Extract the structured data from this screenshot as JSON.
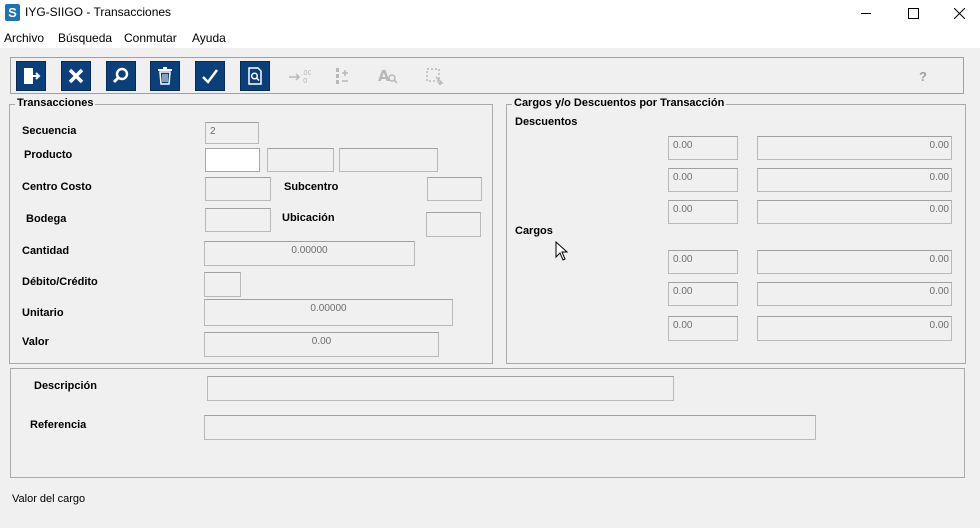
{
  "window": {
    "title": "IYG-SIIGO - Transacciones",
    "logo_letter": "S"
  },
  "menu": {
    "items": [
      "Archivo",
      "Búsqueda",
      "Conmutar",
      "Ayuda"
    ]
  },
  "toolbar": {
    "buttons": [
      {
        "icon": "exit-door-icon",
        "enabled": true
      },
      {
        "icon": "cancel-x-icon",
        "enabled": true
      },
      {
        "icon": "search-magnifier-icon",
        "enabled": true
      },
      {
        "icon": "trash-icon",
        "enabled": true
      },
      {
        "icon": "checkmark-icon",
        "enabled": true
      },
      {
        "icon": "preview-document-icon",
        "enabled": true
      },
      {
        "icon": "sequence-icon",
        "enabled": false
      },
      {
        "icon": "numbering-icon",
        "enabled": false
      },
      {
        "icon": "find-text-icon",
        "enabled": false
      },
      {
        "icon": "select-area-icon",
        "enabled": false
      }
    ],
    "help_label": "?"
  },
  "transacciones": {
    "title": "Transacciones",
    "secuencia_label": "Secuencia",
    "secuencia_value": "2",
    "producto_label": "Producto",
    "centro_costo_label": "Centro Costo",
    "subcentro_label": "Subcentro",
    "bodega_label": "Bodega",
    "ubicacion_label": "Ubicación",
    "cantidad_label": "Cantidad",
    "cantidad_value": "0.00000",
    "debito_credito_label": "Débito/Crédito",
    "unitario_label": "Unitario",
    "unitario_value": "0.00000",
    "valor_label": "Valor",
    "valor_value": "0.00"
  },
  "cargos_descuentos": {
    "title": "Cargos y/o Descuentos por Transacción",
    "descuentos_label": "Descuentos",
    "cargos_label": "Cargos",
    "descuentos_rows": [
      {
        "pct": "0.00",
        "amount": "0.00"
      },
      {
        "pct": "0.00",
        "amount": "0.00"
      },
      {
        "pct": "0.00",
        "amount": "0.00"
      }
    ],
    "cargos_rows": [
      {
        "pct": "0.00",
        "amount": "0.00"
      },
      {
        "pct": "0.00",
        "amount": "0.00"
      },
      {
        "pct": "0.00",
        "amount": "0.00"
      }
    ]
  },
  "bottom": {
    "descripcion_label": "Descripción",
    "referencia_label": "Referencia"
  },
  "status": {
    "text": "Valor del cargo"
  },
  "colors": {
    "toolbar_blue": "#0b3f7a",
    "logo_blue": "#1b73b8"
  }
}
